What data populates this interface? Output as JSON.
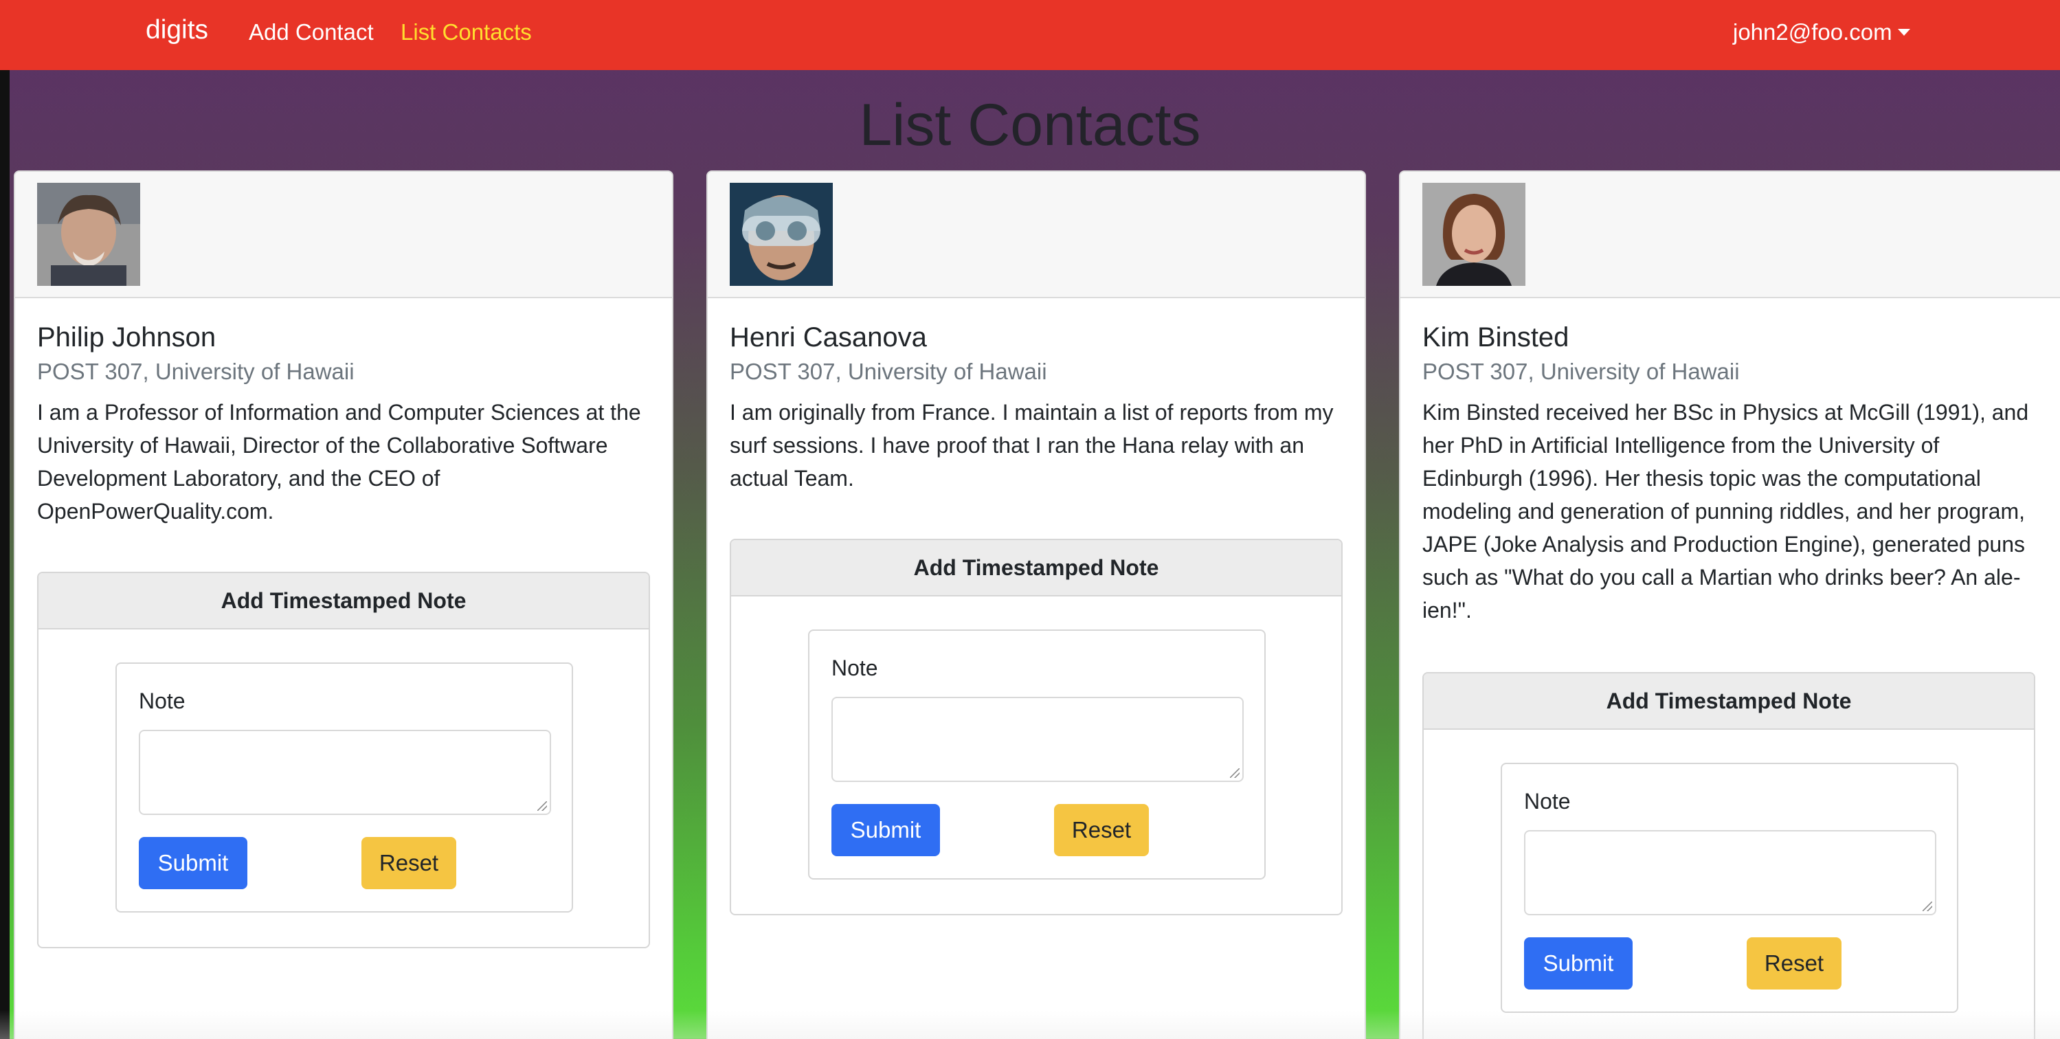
{
  "navbar": {
    "brand": "digits",
    "links": [
      "Add Contact",
      "List Contacts"
    ],
    "user": "john2@foo.com",
    "active_link_color": "#ffdf2f",
    "background_color": "#e83427"
  },
  "page": {
    "title": "List Contacts"
  },
  "contacts": [
    {
      "name": "Philip Johnson",
      "address": "POST 307, University of Hawaii",
      "description": "I am a Professor of Information and Computer Sciences at the University of Hawaii, Director of the Collaborative Software Development Laboratory, and the CEO of OpenPowerQuality.com.",
      "note_title": "Add Timestamped Note",
      "note_label": "Note",
      "submit_label": "Submit",
      "reset_label": "Reset"
    },
    {
      "name": "Henri Casanova",
      "address": "POST 307, University of Hawaii",
      "description": "I am originally from France. I maintain a list of reports from my surf sessions. I have proof that I ran the Hana relay with an actual Team.",
      "note_title": "Add Timestamped Note",
      "note_label": "Note",
      "submit_label": "Submit",
      "reset_label": "Reset"
    },
    {
      "name": "Kim Binsted",
      "address": "POST 307, University of Hawaii",
      "description": "Kim Binsted received her BSc in Physics at McGill (1991), and her PhD in Artificial Intelligence from the University of Edinburgh (1996). Her thesis topic was the computational modeling and generation of punning riddles, and her program, JAPE (Joke Analysis and Production Engine), generated puns such as \"What do you call a Martian who drinks beer? An ale-ien!\".",
      "note_title": "Add Timestamped Note",
      "note_label": "Note",
      "submit_label": "Submit",
      "reset_label": "Reset"
    }
  ],
  "colors": {
    "submit": "#2f6ef3",
    "reset": "#f5c542"
  }
}
